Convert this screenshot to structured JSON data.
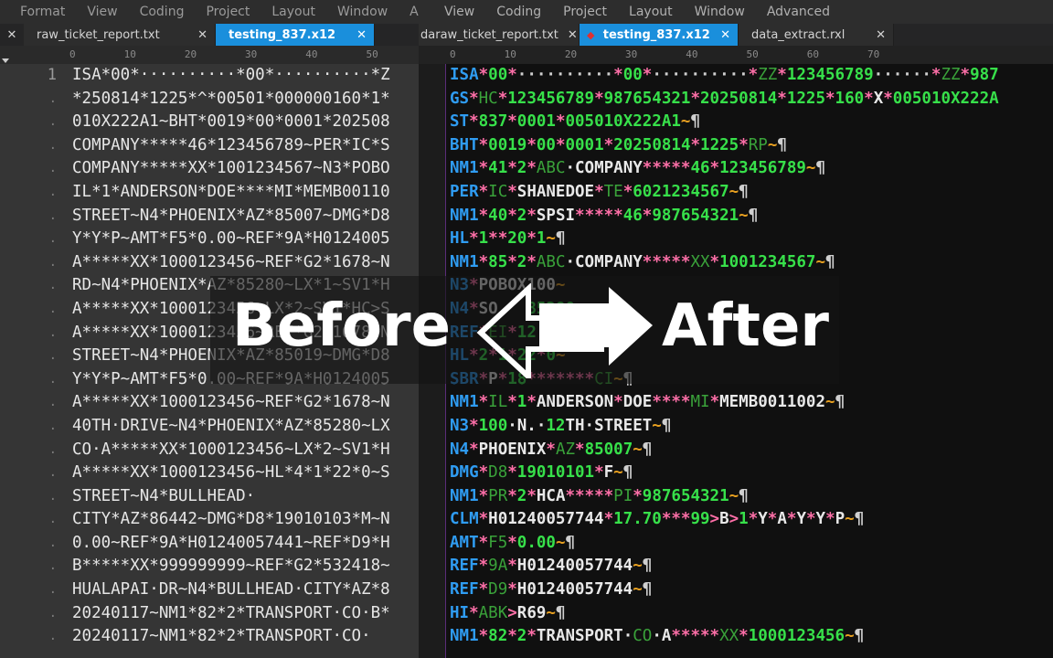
{
  "left_menu": [
    "Format",
    "View",
    "Coding",
    "Project",
    "Layout",
    "Window",
    "Advat"
  ],
  "right_menu": [
    "View",
    "Coding",
    "Project",
    "Layout",
    "Window",
    "Advanced"
  ],
  "left_tabs": [
    {
      "label": "raw_ticket_report.txt",
      "active": false
    },
    {
      "label": "testing_837.x12",
      "active": true
    }
  ],
  "right_tabs": [
    {
      "label": "daraw_ticket_report.txt",
      "active": false
    },
    {
      "label": "testing_837.x12",
      "active": true
    },
    {
      "label": "data_extract.rxl",
      "active": false
    }
  ],
  "left_ruler": "0        10        20        30        40        50",
  "right_ruler": "0        10        20        30        40        50        60        70",
  "left_gutter_first": "1",
  "left_lines": [
    "ISA*00*··········*00*··········*Z",
    "*250814*1225*^*00501*000000160*1*",
    "010X222A1~BHT*0019*00*0001*202508",
    "COMPANY*****46*123456789~PER*IC*S",
    "COMPANY*****XX*1001234567~N3*POBO",
    "IL*1*ANDERSON*DOE****MI*MEMB00110",
    "STREET~N4*PHOENIX*AZ*85007~DMG*D8",
    "Y*Y*P~AMT*F5*0.00~REF*9A*H0124005",
    "A*****XX*1000123456~REF*G2*1678~N",
    "RD~N4*PHOENIX*AZ*85280~LX*1~SV1*H",
    "A*****XX*1000123456~LX*2~SV1*HC>S",
    "A*****XX*1000123456~REF*G2*1678~N",
    "STREET~N4*PHOENIX*AZ*85019~DMG*D8",
    "Y*Y*P~AMT*F5*0.00~REF*9A*H0124005",
    "A*****XX*1000123456~REF*G2*1678~N",
    "40TH·DRIVE~N4*PHOENIX*AZ*85280~LX",
    "CO·A*****XX*1000123456~LX*2~SV1*H",
    "A*****XX*1000123456~HL*4*1*22*0~S",
    "STREET~N4*BULLHEAD·",
    "CITY*AZ*86442~DMG*D8*19010103*M~N",
    "0.00~REF*9A*H01240057441~REF*D9*H",
    "B*****XX*999999999~REF*G2*532418~",
    "HUALAPAI·DR~N4*BULLHEAD·CITY*AZ*8",
    "20240117~NM1*82*2*TRANSPORT·CO·B*",
    "20240117~NM1*82*2*TRANSPORT·CO·"
  ],
  "overlay": {
    "before": "Before",
    "after": "After"
  },
  "colors": {
    "segment": "#2f9cf2",
    "delimiter": "#ff6fa8",
    "qualifier": "#3aa23a",
    "number": "#37e04a",
    "terminator": "#e8a020",
    "tab_active": "#1a8fdc"
  },
  "right_lines": [
    [
      [
        "seg",
        "ISA"
      ],
      [
        "d",
        "*"
      ],
      [
        "n",
        "00"
      ],
      [
        "d",
        "*"
      ],
      [
        "p",
        "··········"
      ],
      [
        "d",
        "*"
      ],
      [
        "n",
        "00"
      ],
      [
        "d",
        "*"
      ],
      [
        "p",
        "··········"
      ],
      [
        "d",
        "*"
      ],
      [
        "q",
        "ZZ"
      ],
      [
        "d",
        "*"
      ],
      [
        "n",
        "123456789"
      ],
      [
        "p",
        "······"
      ],
      [
        "d",
        "*"
      ],
      [
        "q",
        "ZZ"
      ],
      [
        "d",
        "*"
      ],
      [
        "n",
        "987"
      ]
    ],
    [
      [
        "seg",
        "GS"
      ],
      [
        "d",
        "*"
      ],
      [
        "q",
        "HC"
      ],
      [
        "d",
        "*"
      ],
      [
        "n",
        "123456789"
      ],
      [
        "d",
        "*"
      ],
      [
        "n",
        "987654321"
      ],
      [
        "d",
        "*"
      ],
      [
        "n",
        "20250814"
      ],
      [
        "d",
        "*"
      ],
      [
        "n",
        "1225"
      ],
      [
        "d",
        "*"
      ],
      [
        "n",
        "160"
      ],
      [
        "d",
        "*"
      ],
      [
        "el",
        "X"
      ],
      [
        "d",
        "*"
      ],
      [
        "n",
        "005010X222A"
      ]
    ],
    [
      [
        "seg",
        "ST"
      ],
      [
        "d",
        "*"
      ],
      [
        "n",
        "837"
      ],
      [
        "d",
        "*"
      ],
      [
        "n",
        "0001"
      ],
      [
        "d",
        "*"
      ],
      [
        "n",
        "005010X222A1"
      ],
      [
        "t",
        "~"
      ],
      [
        "p",
        "¶"
      ]
    ],
    [
      [
        "seg",
        "BHT"
      ],
      [
        "d",
        "*"
      ],
      [
        "n",
        "0019"
      ],
      [
        "d",
        "*"
      ],
      [
        "n",
        "00"
      ],
      [
        "d",
        "*"
      ],
      [
        "n",
        "0001"
      ],
      [
        "d",
        "*"
      ],
      [
        "n",
        "20250814"
      ],
      [
        "d",
        "*"
      ],
      [
        "n",
        "1225"
      ],
      [
        "d",
        "*"
      ],
      [
        "q",
        "RP"
      ],
      [
        "t",
        "~"
      ],
      [
        "p",
        "¶"
      ]
    ],
    [
      [
        "seg",
        "NM1"
      ],
      [
        "d",
        "*"
      ],
      [
        "n",
        "41"
      ],
      [
        "d",
        "*"
      ],
      [
        "n",
        "2"
      ],
      [
        "d",
        "*"
      ],
      [
        "q",
        "ABC"
      ],
      [
        "el",
        "·COMPANY"
      ],
      [
        "d",
        "*****"
      ],
      [
        "n",
        "46"
      ],
      [
        "d",
        "*"
      ],
      [
        "n",
        "123456789"
      ],
      [
        "t",
        "~"
      ],
      [
        "p",
        "¶"
      ]
    ],
    [
      [
        "seg",
        "PER"
      ],
      [
        "d",
        "*"
      ],
      [
        "q",
        "IC"
      ],
      [
        "d",
        "*"
      ],
      [
        "el",
        "SHANEDOE"
      ],
      [
        "d",
        "*"
      ],
      [
        "q",
        "TE"
      ],
      [
        "d",
        "*"
      ],
      [
        "n",
        "6021234567"
      ],
      [
        "t",
        "~"
      ],
      [
        "p",
        "¶"
      ]
    ],
    [
      [
        "seg",
        "NM1"
      ],
      [
        "d",
        "*"
      ],
      [
        "n",
        "40"
      ],
      [
        "d",
        "*"
      ],
      [
        "n",
        "2"
      ],
      [
        "d",
        "*"
      ],
      [
        "el",
        "SPSI"
      ],
      [
        "d",
        "*****"
      ],
      [
        "n",
        "46"
      ],
      [
        "d",
        "*"
      ],
      [
        "n",
        "987654321"
      ],
      [
        "t",
        "~"
      ],
      [
        "p",
        "¶"
      ]
    ],
    [
      [
        "seg",
        "HL"
      ],
      [
        "d",
        "*"
      ],
      [
        "n",
        "1"
      ],
      [
        "d",
        "**"
      ],
      [
        "n",
        "20"
      ],
      [
        "d",
        "*"
      ],
      [
        "n",
        "1"
      ],
      [
        "t",
        "~"
      ],
      [
        "p",
        "¶"
      ]
    ],
    [
      [
        "seg",
        "NM1"
      ],
      [
        "d",
        "*"
      ],
      [
        "n",
        "85"
      ],
      [
        "d",
        "*"
      ],
      [
        "n",
        "2"
      ],
      [
        "d",
        "*"
      ],
      [
        "q",
        "ABC"
      ],
      [
        "el",
        "·COMPANY"
      ],
      [
        "d",
        "*****"
      ],
      [
        "q",
        "XX"
      ],
      [
        "d",
        "*"
      ],
      [
        "n",
        "1001234567"
      ],
      [
        "t",
        "~"
      ],
      [
        "p",
        "¶"
      ]
    ],
    [
      [
        "seg",
        "N3"
      ],
      [
        "d",
        "*"
      ],
      [
        "el",
        "POBOX100"
      ],
      [
        "t",
        "~"
      ]
    ],
    [
      [
        "seg",
        "N4"
      ],
      [
        "d",
        "*"
      ],
      [
        "el",
        "SO"
      ],
      [
        "p",
        "   "
      ],
      [
        "n",
        "85280"
      ]
    ],
    [
      [
        "seg",
        "REF"
      ],
      [
        "d",
        "*"
      ],
      [
        "q",
        "EI"
      ],
      [
        "d",
        "*"
      ],
      [
        "n",
        "12"
      ]
    ],
    [
      [
        "seg",
        "HL"
      ],
      [
        "d",
        "*"
      ],
      [
        "n",
        "2"
      ],
      [
        "d",
        "*"
      ],
      [
        "n",
        "1"
      ],
      [
        "d",
        "*"
      ],
      [
        "n",
        "22"
      ],
      [
        "d",
        "*"
      ],
      [
        "n",
        "0"
      ],
      [
        "t",
        "~"
      ]
    ],
    [
      [
        "seg",
        "SBR"
      ],
      [
        "d",
        "*"
      ],
      [
        "el",
        "P"
      ],
      [
        "d",
        "*"
      ],
      [
        "n",
        "18"
      ],
      [
        "d",
        "*******"
      ],
      [
        "q",
        "CI"
      ],
      [
        "t",
        "~"
      ],
      [
        "p",
        "¶"
      ]
    ],
    [
      [
        "seg",
        "NM1"
      ],
      [
        "d",
        "*"
      ],
      [
        "q",
        "IL"
      ],
      [
        "d",
        "*"
      ],
      [
        "n",
        "1"
      ],
      [
        "d",
        "*"
      ],
      [
        "el",
        "ANDERSON"
      ],
      [
        "d",
        "*"
      ],
      [
        "el",
        "DOE"
      ],
      [
        "d",
        "****"
      ],
      [
        "q",
        "MI"
      ],
      [
        "d",
        "*"
      ],
      [
        "el",
        "MEMB0011002"
      ],
      [
        "t",
        "~"
      ],
      [
        "p",
        "¶"
      ]
    ],
    [
      [
        "seg",
        "N3"
      ],
      [
        "d",
        "*"
      ],
      [
        "n",
        "100"
      ],
      [
        "el",
        "·N.·"
      ],
      [
        "n",
        "12"
      ],
      [
        "el",
        "TH·STREET"
      ],
      [
        "t",
        "~"
      ],
      [
        "p",
        "¶"
      ]
    ],
    [
      [
        "seg",
        "N4"
      ],
      [
        "d",
        "*"
      ],
      [
        "el",
        "PHOENIX"
      ],
      [
        "d",
        "*"
      ],
      [
        "q",
        "AZ"
      ],
      [
        "d",
        "*"
      ],
      [
        "n",
        "85007"
      ],
      [
        "t",
        "~"
      ],
      [
        "p",
        "¶"
      ]
    ],
    [
      [
        "seg",
        "DMG"
      ],
      [
        "d",
        "*"
      ],
      [
        "q",
        "D8"
      ],
      [
        "d",
        "*"
      ],
      [
        "n",
        "19010101"
      ],
      [
        "d",
        "*"
      ],
      [
        "el",
        "F"
      ],
      [
        "t",
        "~"
      ],
      [
        "p",
        "¶"
      ]
    ],
    [
      [
        "seg",
        "NM1"
      ],
      [
        "d",
        "*"
      ],
      [
        "q",
        "PR"
      ],
      [
        "d",
        "*"
      ],
      [
        "n",
        "2"
      ],
      [
        "d",
        "*"
      ],
      [
        "el",
        "HCA"
      ],
      [
        "d",
        "*****"
      ],
      [
        "q",
        "PI"
      ],
      [
        "d",
        "*"
      ],
      [
        "n",
        "987654321"
      ],
      [
        "t",
        "~"
      ],
      [
        "p",
        "¶"
      ]
    ],
    [
      [
        "seg",
        "CLM"
      ],
      [
        "d",
        "*"
      ],
      [
        "el",
        "H01240057744"
      ],
      [
        "d",
        "*"
      ],
      [
        "n",
        "17.70"
      ],
      [
        "d",
        "***"
      ],
      [
        "n",
        "99"
      ],
      [
        "d",
        ">"
      ],
      [
        "el",
        "B"
      ],
      [
        "d",
        ">"
      ],
      [
        "n",
        "1"
      ],
      [
        "d",
        "*"
      ],
      [
        "el",
        "Y"
      ],
      [
        "d",
        "*"
      ],
      [
        "el",
        "A"
      ],
      [
        "d",
        "*"
      ],
      [
        "el",
        "Y"
      ],
      [
        "d",
        "*"
      ],
      [
        "el",
        "Y"
      ],
      [
        "d",
        "*"
      ],
      [
        "el",
        "P"
      ],
      [
        "t",
        "~"
      ],
      [
        "p",
        "¶"
      ]
    ],
    [
      [
        "seg",
        "AMT"
      ],
      [
        "d",
        "*"
      ],
      [
        "q",
        "F5"
      ],
      [
        "d",
        "*"
      ],
      [
        "n",
        "0.00"
      ],
      [
        "t",
        "~"
      ],
      [
        "p",
        "¶"
      ]
    ],
    [
      [
        "seg",
        "REF"
      ],
      [
        "d",
        "*"
      ],
      [
        "q",
        "9A"
      ],
      [
        "d",
        "*"
      ],
      [
        "el",
        "H01240057744"
      ],
      [
        "t",
        "~"
      ],
      [
        "p",
        "¶"
      ]
    ],
    [
      [
        "seg",
        "REF"
      ],
      [
        "d",
        "*"
      ],
      [
        "q",
        "D9"
      ],
      [
        "d",
        "*"
      ],
      [
        "el",
        "H01240057744"
      ],
      [
        "t",
        "~"
      ],
      [
        "p",
        "¶"
      ]
    ],
    [
      [
        "seg",
        "HI"
      ],
      [
        "d",
        "*"
      ],
      [
        "q",
        "ABK"
      ],
      [
        "d",
        ">"
      ],
      [
        "el",
        "R69"
      ],
      [
        "t",
        "~"
      ],
      [
        "p",
        "¶"
      ]
    ],
    [
      [
        "seg",
        "NM1"
      ],
      [
        "d",
        "*"
      ],
      [
        "n",
        "82"
      ],
      [
        "d",
        "*"
      ],
      [
        "n",
        "2"
      ],
      [
        "d",
        "*"
      ],
      [
        "el",
        "TRANSPORT·"
      ],
      [
        "q",
        "CO"
      ],
      [
        "el",
        "·A"
      ],
      [
        "d",
        "*****"
      ],
      [
        "q",
        "XX"
      ],
      [
        "d",
        "*"
      ],
      [
        "n",
        "1000123456"
      ],
      [
        "t",
        "~"
      ],
      [
        "p",
        "¶"
      ]
    ]
  ]
}
